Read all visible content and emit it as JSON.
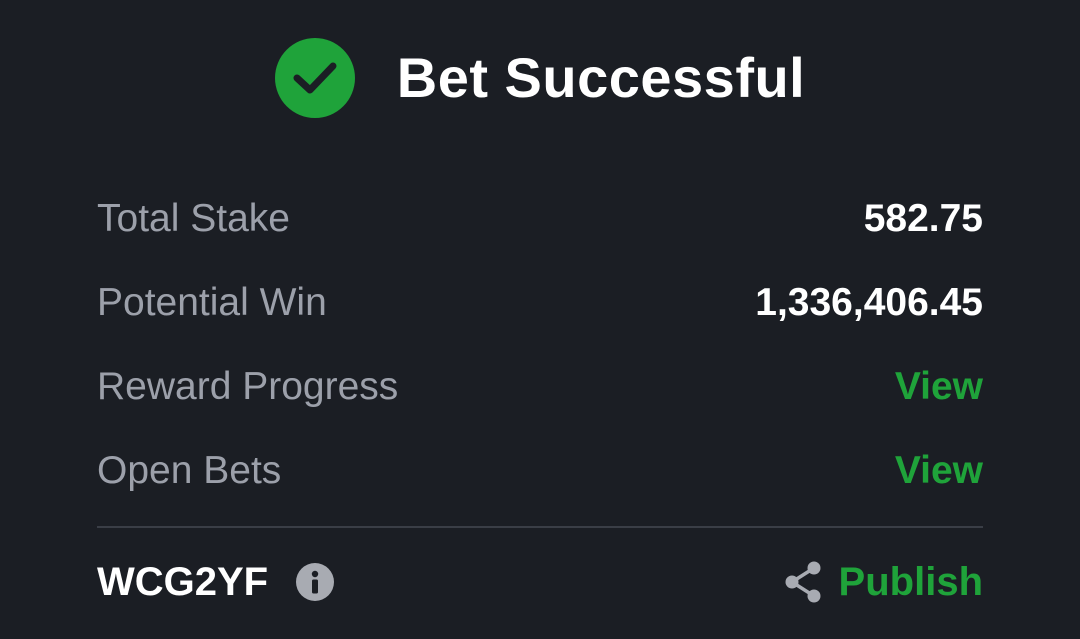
{
  "header": {
    "title": "Bet Successful",
    "icon": "check-circle-icon",
    "icon_color": "#1fa33a"
  },
  "summary": {
    "rows": [
      {
        "label": "Total Stake",
        "value": "582.75"
      },
      {
        "label": "Potential Win",
        "value": "1,336,406.45"
      },
      {
        "label": "Reward Progress",
        "link": "View"
      },
      {
        "label": "Open Bets",
        "link": "View"
      }
    ]
  },
  "footer": {
    "booking_code": "WCG2YF",
    "info_icon": "info-icon",
    "share_icon": "share-icon",
    "publish_label": "Publish"
  },
  "colors": {
    "background": "#1b1e24",
    "accent": "#1fa33a",
    "label": "#9ca0aa",
    "value": "#ffffff"
  }
}
